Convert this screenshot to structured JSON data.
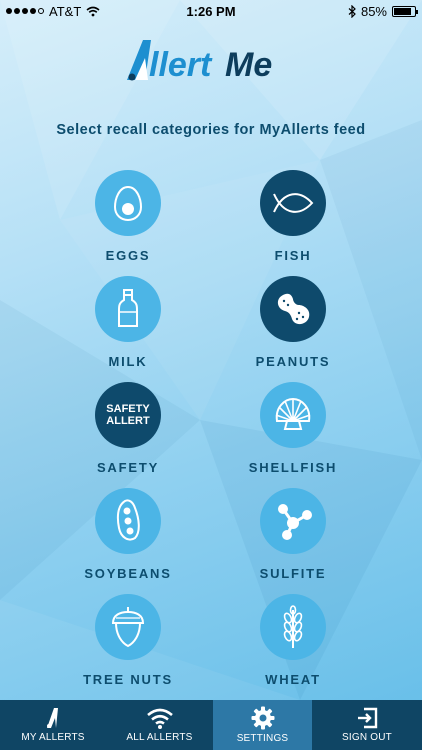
{
  "status": {
    "carrier": "AT&T",
    "time": "1:26 PM",
    "battery": "85%",
    "battery_level": 0.85
  },
  "app": {
    "logo_text": "AllertMe"
  },
  "prompt": "Select recall categories for MyAllerts feed",
  "categories": [
    {
      "label": "EGGS",
      "icon": "egg-icon",
      "selected": false
    },
    {
      "label": "FISH",
      "icon": "fish-icon",
      "selected": true
    },
    {
      "label": "MILK",
      "icon": "milk-bottle-icon",
      "selected": false
    },
    {
      "label": "PEANUTS",
      "icon": "peanut-icon",
      "selected": true
    },
    {
      "label": "SAFETY",
      "icon": "safety-alert-icon",
      "icon_text": [
        "SAFETY",
        "ALLERT"
      ],
      "selected": true
    },
    {
      "label": "SHELLFISH",
      "icon": "shell-icon",
      "selected": false
    },
    {
      "label": "SOYBEANS",
      "icon": "soybean-icon",
      "selected": false
    },
    {
      "label": "SULFITE",
      "icon": "molecule-icon",
      "selected": false
    },
    {
      "label": "TREE NUTS",
      "icon": "acorn-icon",
      "selected": false
    },
    {
      "label": "WHEAT",
      "icon": "wheat-icon",
      "selected": false
    }
  ],
  "tabs": [
    {
      "label": "MY ALLERTS",
      "icon": "my-allerts-logo-icon",
      "active": false
    },
    {
      "label": "ALL ALLERTS",
      "icon": "wifi-broadcast-icon",
      "active": false
    },
    {
      "label": "SETTINGS",
      "icon": "gear-icon",
      "active": true
    },
    {
      "label": "SIGN OUT",
      "icon": "sign-out-icon",
      "active": false
    }
  ],
  "colors": {
    "unselected_circle": "#4cb5e6",
    "selected_circle": "#0e4a6c",
    "label_text": "#0d4d6e",
    "tabbar": "#0f4564",
    "tab_active": "#2d78a6",
    "logo_blue": "#1d8fd0",
    "logo_navy": "#0d3d5c"
  }
}
